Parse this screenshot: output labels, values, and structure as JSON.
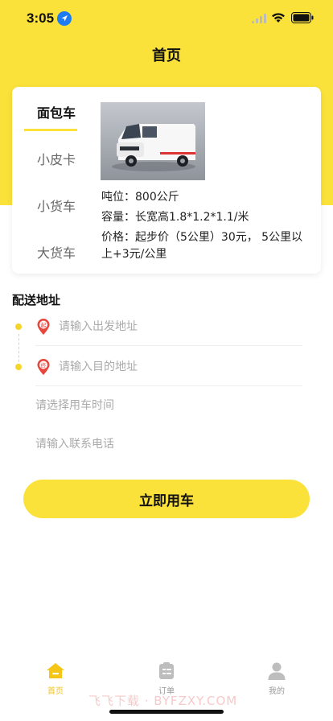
{
  "status_bar": {
    "time": "3:05"
  },
  "header": {
    "title": "首页"
  },
  "vehicle_tabs": [
    {
      "label": "面包车",
      "active": true
    },
    {
      "label": "小皮卡",
      "active": false
    },
    {
      "label": "小货车",
      "active": false
    },
    {
      "label": "大货车",
      "active": false
    }
  ],
  "vehicle": {
    "tonnage": "吨位：800公斤",
    "capacity": "容量：长宽高1.8*1.2*1.1/米",
    "price_line1": "价格：起步价（5公里）30元， 5公里以",
    "price_line2": "上+3元/公里"
  },
  "delivery": {
    "section_title": "配送地址",
    "start_pin_label": "起",
    "end_pin_label": "终",
    "start_placeholder": "请输入出发地址",
    "end_placeholder": "请输入目的地址",
    "time_placeholder": "请选择用车时间",
    "phone_placeholder": "请输入联系电话"
  },
  "submit_label": "立即用车",
  "bottom_nav": [
    {
      "label": "首页",
      "icon": "home-icon",
      "active": true
    },
    {
      "label": "订单",
      "icon": "orders-icon",
      "active": false
    },
    {
      "label": "我的",
      "icon": "profile-icon",
      "active": false
    }
  ],
  "watermark": "飞飞下载 · BYFZXY.COM",
  "colors": {
    "accent": "#FBE23A",
    "pin_red": "#E8453C",
    "nav_active": "#F5C518"
  }
}
